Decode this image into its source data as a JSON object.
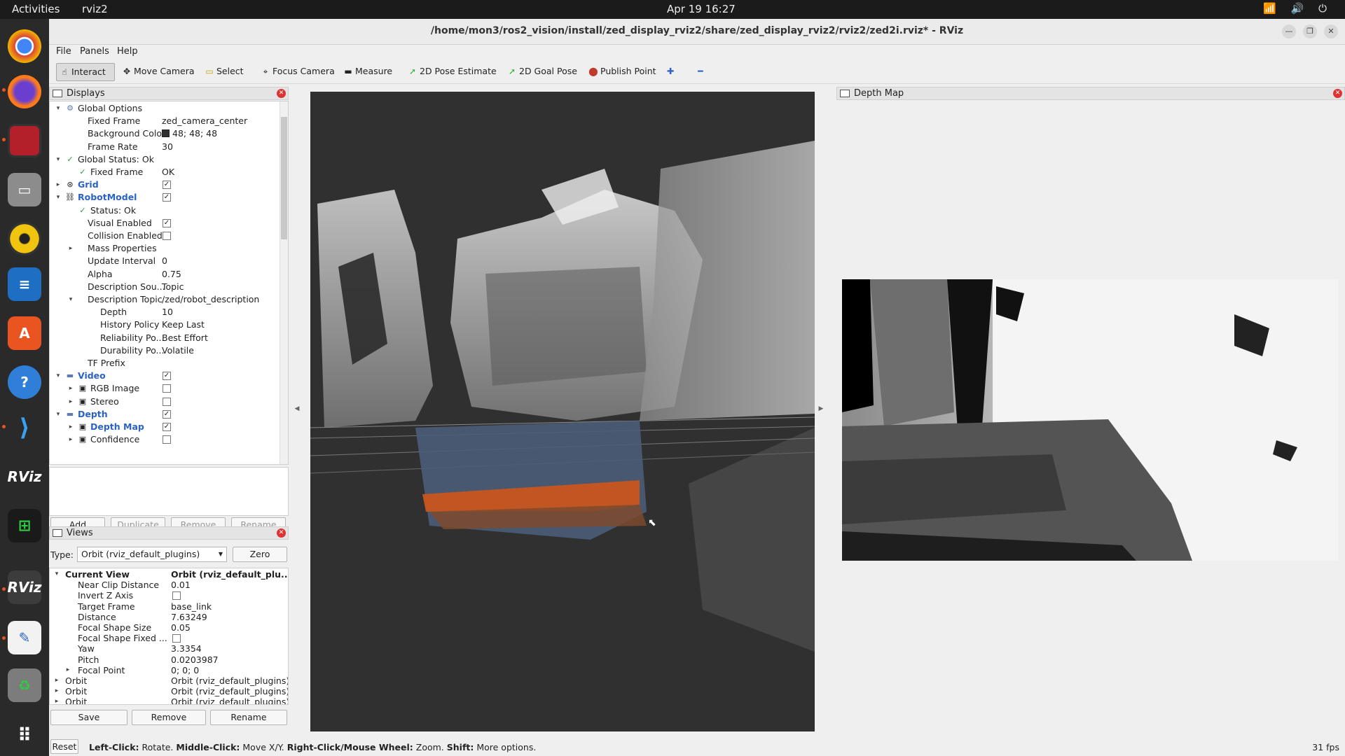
{
  "topbar": {
    "activities": "Activities",
    "app_name": "rviz2",
    "clock": "Apr 19  16:27",
    "tray": "📶 🔊 ⏻"
  },
  "window": {
    "title": "/home/mon3/ros2_vision/install/zed_display_rviz2/share/zed_display_rviz2/rviz2/zed2i.rviz* - RViz"
  },
  "menu": {
    "file": "File",
    "panels": "Panels",
    "help": "Help"
  },
  "toolbar": {
    "interact": "Interact",
    "move_camera": "Move Camera",
    "select": "Select",
    "focus_camera": "Focus Camera",
    "measure": "Measure",
    "pose_estimate": "2D Pose Estimate",
    "goal_pose": "2D Goal Pose",
    "publish_point": "Publish Point",
    "plus": "✚",
    "minus": "━"
  },
  "displays": {
    "title": "Displays",
    "rows": [
      {
        "label": "Global Options",
        "value": ""
      },
      {
        "label": "Fixed Frame",
        "value": "zed_camera_center"
      },
      {
        "label": "Background Color",
        "value": "48; 48; 48"
      },
      {
        "label": "Frame Rate",
        "value": "30"
      },
      {
        "label": "Global Status: Ok",
        "value": ""
      },
      {
        "label": "Fixed Frame",
        "value": "OK"
      },
      {
        "label": "Grid",
        "value": ""
      },
      {
        "label": "RobotModel",
        "value": ""
      },
      {
        "label": "Status: Ok",
        "value": ""
      },
      {
        "label": "Visual Enabled",
        "value": ""
      },
      {
        "label": "Collision Enabled",
        "value": ""
      },
      {
        "label": "Mass Properties",
        "value": ""
      },
      {
        "label": "Update Interval",
        "value": "0"
      },
      {
        "label": "Alpha",
        "value": "0.75"
      },
      {
        "label": "Description Sou...",
        "value": "Topic"
      },
      {
        "label": "Description Topic",
        "value": "/zed/robot_description"
      },
      {
        "label": "Depth",
        "value": "10"
      },
      {
        "label": "History Policy",
        "value": "Keep Last"
      },
      {
        "label": "Reliability Po...",
        "value": "Best Effort"
      },
      {
        "label": "Durability Po...",
        "value": "Volatile"
      },
      {
        "label": "TF Prefix",
        "value": ""
      },
      {
        "label": "Video",
        "value": ""
      },
      {
        "label": "RGB Image",
        "value": ""
      },
      {
        "label": "Stereo",
        "value": ""
      },
      {
        "label": "Depth",
        "value": ""
      },
      {
        "label": "Depth Map",
        "value": ""
      },
      {
        "label": "Confidence",
        "value": ""
      }
    ],
    "buttons": {
      "add": "Add",
      "duplicate": "Duplicate",
      "remove": "Remove",
      "rename": "Rename"
    }
  },
  "views": {
    "title": "Views",
    "type_label": "Type:",
    "type_value": "Orbit (rviz_default_plugins)",
    "zero": "Zero",
    "rows": [
      {
        "label": "Current View",
        "value": "Orbit (rviz_default_plu..."
      },
      {
        "label": "Near Clip Distance",
        "value": "0.01"
      },
      {
        "label": "Invert Z Axis",
        "value": ""
      },
      {
        "label": "Target Frame",
        "value": "base_link"
      },
      {
        "label": "Distance",
        "value": "7.63249"
      },
      {
        "label": "Focal Shape Size",
        "value": "0.05"
      },
      {
        "label": "Focal Shape Fixed ...",
        "value": ""
      },
      {
        "label": "Yaw",
        "value": "3.3354"
      },
      {
        "label": "Pitch",
        "value": "0.0203987"
      },
      {
        "label": "Focal Point",
        "value": "0; 0; 0"
      },
      {
        "label": "Orbit",
        "value": "Orbit (rviz_default_plugins)"
      },
      {
        "label": "Orbit",
        "value": "Orbit (rviz_default_plugins)"
      },
      {
        "label": "Orbit",
        "value": "Orbit (rviz_default_plugins)"
      }
    ],
    "buttons": {
      "save": "Save",
      "remove": "Remove",
      "rename": "Rename"
    }
  },
  "depth_panel": {
    "title": "Depth Map"
  },
  "status": {
    "reset": "Reset",
    "left_click": "Left-Click:",
    "left_click_action": " Rotate. ",
    "middle_click": "Middle-Click:",
    "middle_click_action": " Move X/Y. ",
    "right_click": "Right-Click/Mouse Wheel:",
    "right_click_action": " Zoom. ",
    "shift": "Shift:",
    "shift_action": " More options.",
    "fps": "31 fps"
  }
}
